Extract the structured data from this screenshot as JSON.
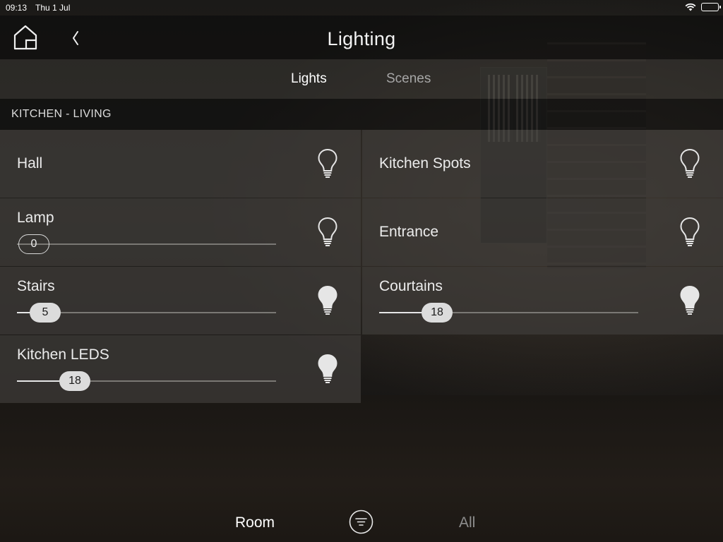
{
  "status_bar": {
    "time": "09:13",
    "date": "Thu 1 Jul",
    "wifi_icon": "wifi-icon",
    "battery_icon": "battery-icon"
  },
  "header": {
    "title": "Lighting",
    "home_icon": "home-icon",
    "back_icon": "chevron-left-icon"
  },
  "tabs": {
    "lights": "Lights",
    "scenes": "Scenes",
    "active": "Lights"
  },
  "section": {
    "title": "KITCHEN - LIVING"
  },
  "lights": [
    {
      "name": "Hall",
      "type": "switch",
      "state": "off",
      "icon": "lightbulb-outline-icon"
    },
    {
      "name": "Kitchen Spots",
      "type": "switch",
      "state": "off",
      "icon": "lightbulb-outline-icon"
    },
    {
      "name": "Lamp",
      "type": "dimmer",
      "value": "0",
      "state": "off",
      "icon": "lightbulb-outline-icon"
    },
    {
      "name": "Entrance",
      "type": "switch",
      "state": "off",
      "icon": "lightbulb-outline-icon"
    },
    {
      "name": "Stairs",
      "type": "dimmer",
      "value": "5",
      "state": "on",
      "icon": "lightbulb-filled-icon"
    },
    {
      "name": "Courtains",
      "type": "dimmer",
      "value": "18",
      "state": "on",
      "icon": "lightbulb-filled-icon"
    },
    {
      "name": "Kitchen LEDS",
      "type": "dimmer",
      "value": "18",
      "state": "on",
      "icon": "lightbulb-filled-icon"
    }
  ],
  "bottom_bar": {
    "room": "Room",
    "all": "All",
    "filter_icon": "filter-icon",
    "active": "Room"
  },
  "colors": {
    "tile_bg": "#3e3c39",
    "thumb_on": "#dcdcdc",
    "text_active": "#ffffff",
    "text_inactive": "#a6a6a6"
  }
}
